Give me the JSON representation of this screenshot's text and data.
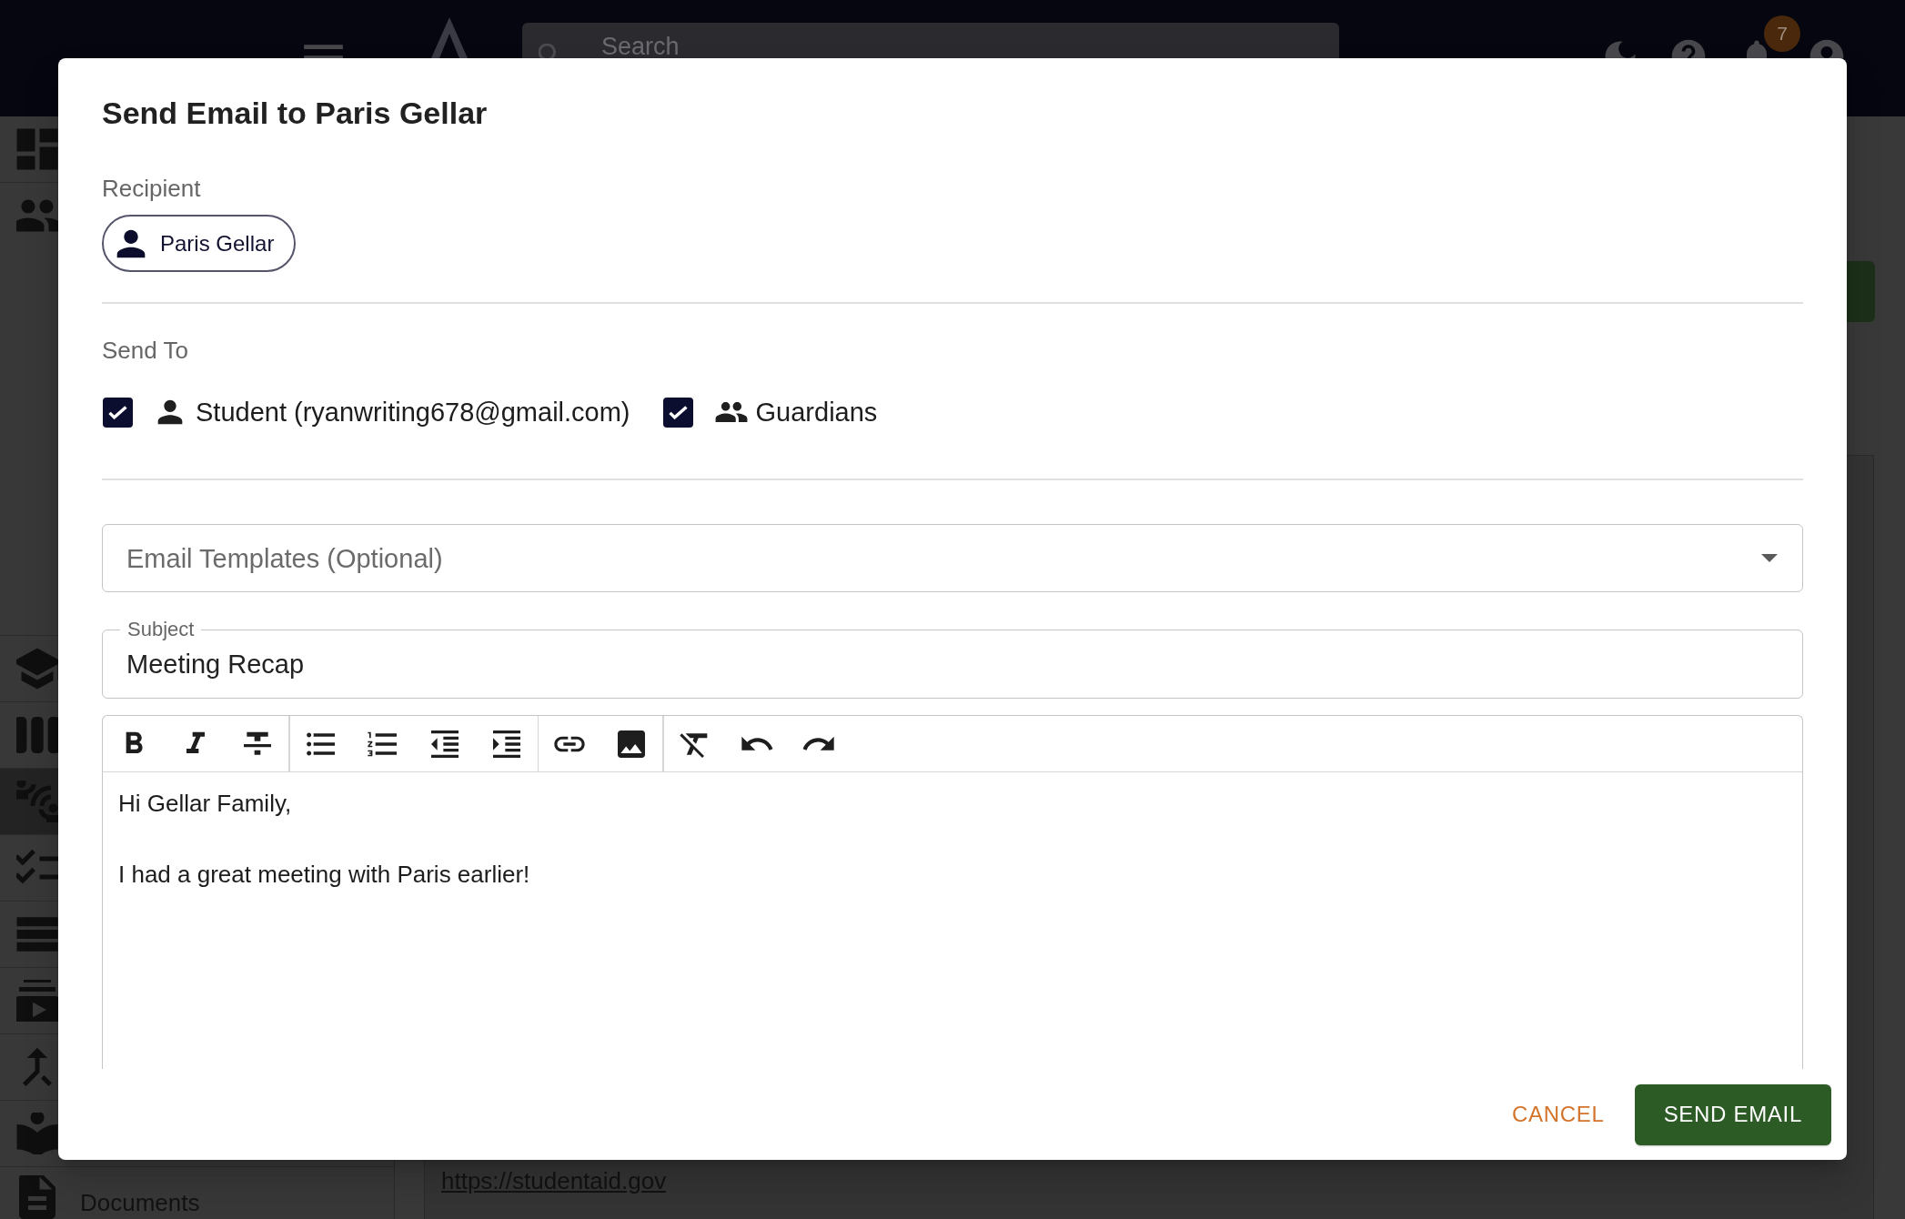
{
  "top_bar": {
    "search": {
      "placeholder": "Search"
    },
    "notification_count": "7"
  },
  "sidebar": {
    "items": [
      {
        "selected": false
      },
      {
        "selected": false
      },
      {
        "selected": false
      },
      {
        "selected": false
      },
      {
        "selected": true
      },
      {
        "selected": false
      },
      {
        "selected": false
      },
      {
        "selected": false
      },
      {
        "selected": false
      },
      {
        "selected": false
      },
      {
        "label": "Documents",
        "selected": false
      }
    ]
  },
  "main": {
    "link": "https://studentaid.gov"
  },
  "dialog": {
    "title": "Send Email to Paris Gellar",
    "recipient": {
      "label": "Recipient",
      "chip": "Paris Gellar"
    },
    "send_to": {
      "label": "Send To",
      "options": [
        {
          "label": "Student (ryanwriting678@gmail.com)",
          "checked": true
        },
        {
          "label": "Guardians",
          "checked": true
        }
      ]
    },
    "template_select": {
      "placeholder": "Email Templates (Optional)"
    },
    "subject": {
      "label": "Subject",
      "value": "Meeting Recap"
    },
    "editor": {
      "paragraphs": [
        "Hi Gellar Family,",
        "I had a great meeting with Paris earlier!"
      ]
    },
    "actions": [
      {
        "label": "CANCEL",
        "kind": "text"
      },
      {
        "label": "SEND EMAIL",
        "kind": "contained"
      }
    ]
  }
}
